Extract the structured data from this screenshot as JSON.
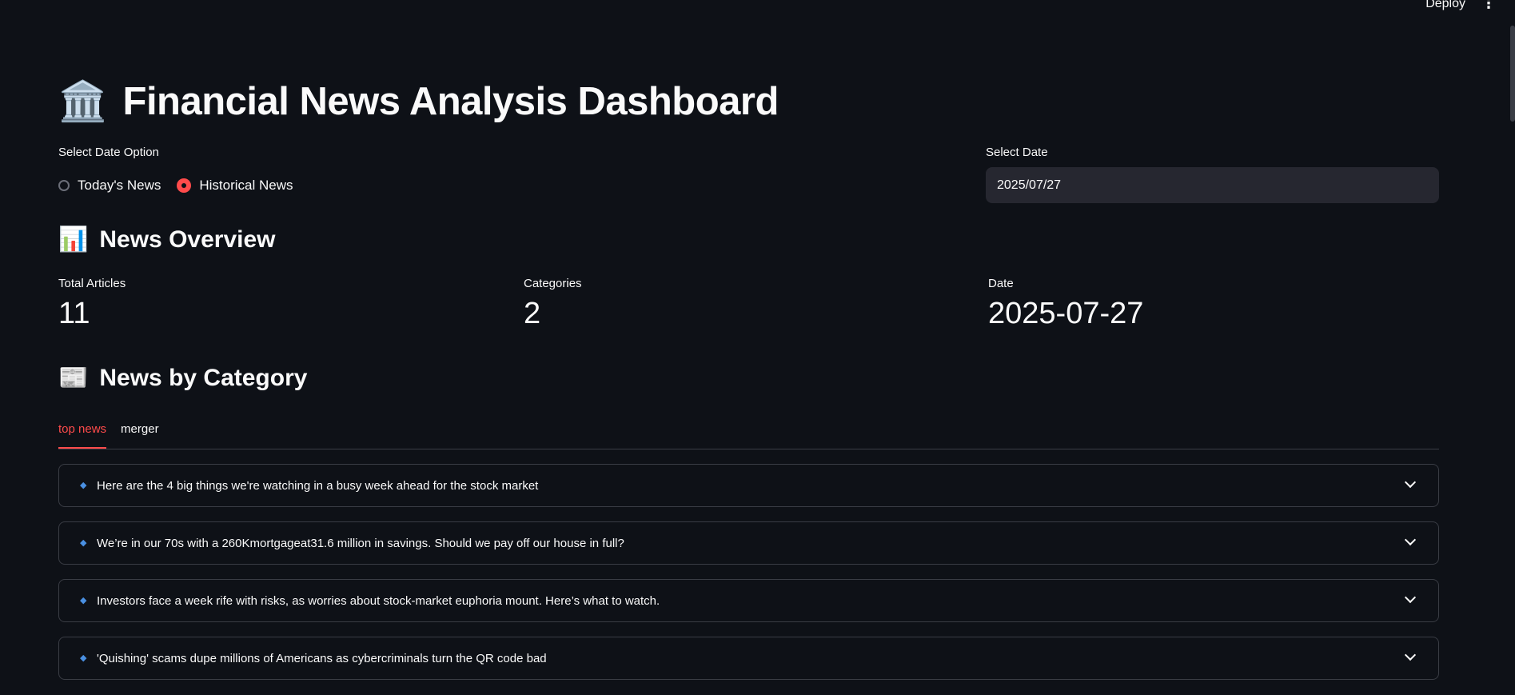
{
  "topbar": {
    "deploy_label": "Deploy",
    "menu_glyph": "⋮"
  },
  "header": {
    "icon": "🏛️",
    "title": "Financial News Analysis Dashboard"
  },
  "date_option": {
    "label": "Select Date Option",
    "options": [
      {
        "label": "Today's News",
        "selected": false
      },
      {
        "label": "Historical News",
        "selected": true
      }
    ]
  },
  "select_date": {
    "label": "Select Date",
    "value": "2025/07/27"
  },
  "overview": {
    "icon": "📊",
    "heading": "News Overview",
    "metrics": [
      {
        "label": "Total Articles",
        "value": "11"
      },
      {
        "label": "Categories",
        "value": "2"
      },
      {
        "label": "Date",
        "value": "2025-07-27"
      }
    ]
  },
  "by_category": {
    "icon": "📰",
    "heading": "News by Category",
    "tabs": [
      {
        "label": "top news",
        "active": true
      },
      {
        "label": "merger",
        "active": false
      }
    ],
    "items": [
      {
        "title": "Here are the 4 big things we're watching in a busy week ahead for the stock market"
      },
      {
        "title": "We’re in our 70s with a 260Kmortgageat31.6 million in savings. Should we pay off our house in full?"
      },
      {
        "title": "Investors face a week rife with risks, as worries about stock-market euphoria mount. Here’s what to watch."
      },
      {
        "title": "'Quishing' scams dupe millions of Americans as cybercriminals turn the QR code bad"
      }
    ]
  },
  "colors": {
    "background": "#0e1117",
    "accent": "#ff4b4b",
    "input_bg": "#262730",
    "border": "#3a3d45",
    "bullet": "#4a90e2"
  }
}
